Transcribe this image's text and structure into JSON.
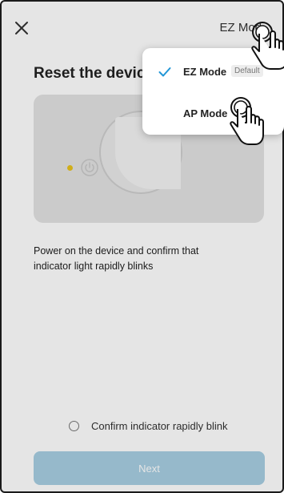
{
  "header": {
    "close_icon": "close-icon",
    "mode_link": "EZ Mod"
  },
  "title": "Reset the devic",
  "instruction": "Power on the device and confirm that indicator light rapidly blinks",
  "confirm_label": "Confirm indicator rapidly blink",
  "next_label": "Next",
  "menu": {
    "items": [
      {
        "label": "EZ Mode",
        "badge": "Default",
        "selected": true
      },
      {
        "label": "AP Mode",
        "badge": "",
        "selected": false
      }
    ]
  },
  "colors": {
    "accent": "#2196d6",
    "button_disabled": "#a8cfe3",
    "led": "#e8c21d"
  }
}
